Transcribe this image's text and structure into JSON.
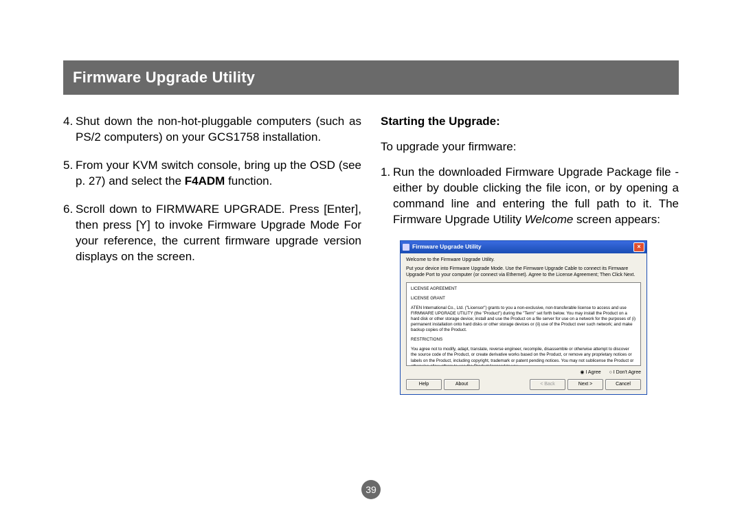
{
  "banner": "Firmware Upgrade Utility",
  "page_number": "39",
  "left": {
    "item4_num": "4.",
    "item4": "Shut down the non-hot-pluggable computers (such as PS/2 computers) on your GCS1758 installation.",
    "item5_num": "5.",
    "item5_a": "From your KVM switch console, bring up the OSD (see p. 27) and select the ",
    "item5_b": "F4ADM",
    "item5_c": " function.",
    "item6_num": "6.",
    "item6": "Scroll down to FIRMWARE UPGRADE. Press [Enter], then press [Y] to invoke Firmware Upgrade Mode For your reference, the current firmware upgrade version displays on the screen."
  },
  "right": {
    "subhead": "Starting the Upgrade:",
    "lead": "To upgrade your firmware:",
    "item1_num": "1.",
    "item1_a": "Run the downloaded Firmware Upgrade Package file - either by double clicking the file icon, or by opening a command line and entering the full path to it. The Firmware Upgrade Utility ",
    "item1_b": "Welcome",
    "item1_c": " screen appears:"
  },
  "dialog": {
    "title": "Firmware Upgrade Utility",
    "welcome": "Welcome to the Firmware Upgrade Utility.",
    "instruct": "Put your device into Firmware Upgrade Mode. Use the Firmware Upgrade Cable to connect its Firmware Upgrade Port to your computer (or connect via Ethernet). Agree to the License Agreement; Then Click Next.",
    "la_head": "LICENSE AGREEMENT",
    "lg_head": "LICENSE GRANT",
    "lg_body": "ATEN International Co., Ltd. (\"Licensor\") grants to you a non-exclusive, non-transferable license to access and use FIRMWARE UPGRADE UTILITY (the \"Product\") during the \"Term\" set forth below. You may install the Product on a hard disk or other storage device; install and use the Product on a file server for use on a network for the purposes of (i) permanent installation onto hard disks or other storage devices or (ii) use of the Product over such network; and make backup copies of the Product.",
    "res_head": "RESTRICTIONS",
    "res_body": "You agree not to modify, adapt, translate, reverse engineer, recompile, disassemble or otherwise attempt to discover the source code of the Product, or create derivative works based on the Product, or remove any proprietary notices or labels on the Product, including copyright, trademark or patent pending notices. You may not sublicense the Product or otherwise allow others to use the Product licensed to you.",
    "agree": "I Agree",
    "disagree": "I Don't Agree",
    "help": "Help",
    "about": "About",
    "back": "< Back",
    "next": "Next >",
    "cancel": "Cancel"
  }
}
